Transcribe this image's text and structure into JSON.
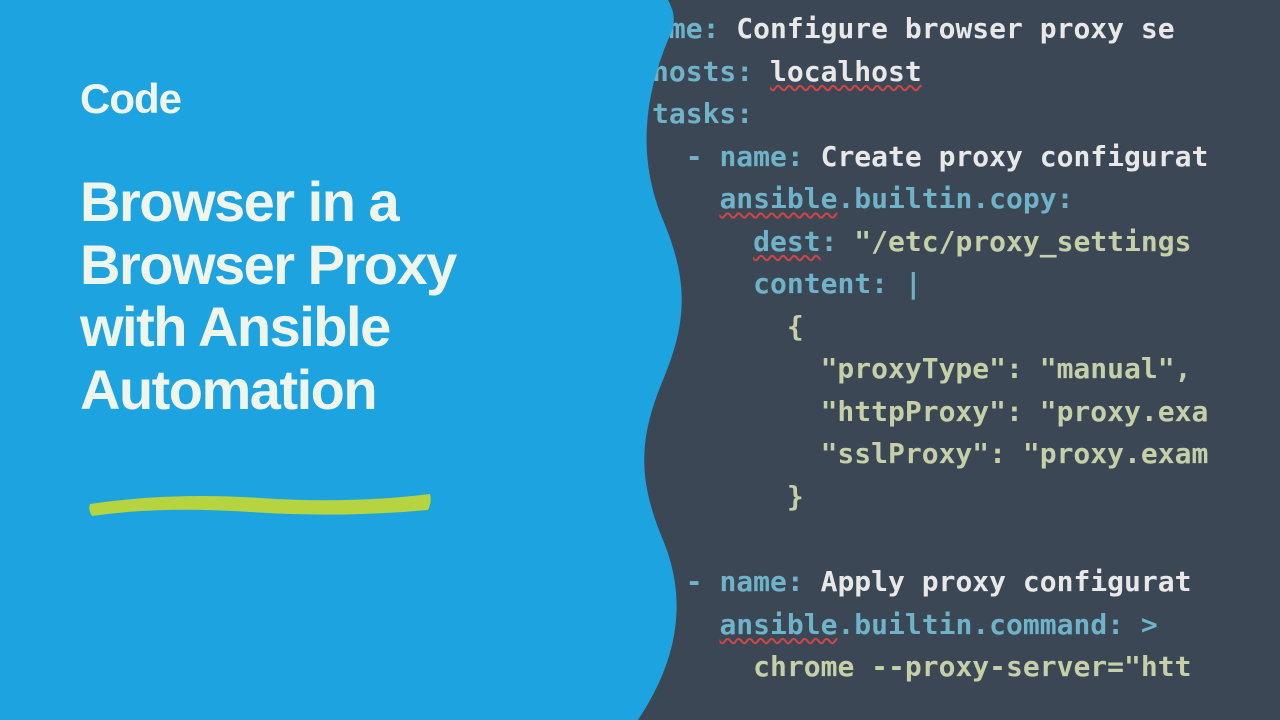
{
  "left": {
    "category": "Code",
    "title": "Browser in a Browser Proxy with Ansible Automation"
  },
  "code": {
    "l1_key": "ame:",
    "l1_val": " Configure browser proxy se",
    "l2_key": "hosts:",
    "l2_val": " localhost",
    "l3_key": "tasks:",
    "l4_dash": "  - ",
    "l4_key": "name:",
    "l4_val": " Create proxy configurat",
    "l5_pad": "    ",
    "l5_key": "ansible.builtin.copy:",
    "l6_pad": "      ",
    "l6_key": "dest:",
    "l6_val": " \"/etc/proxy_settings",
    "l7_pad": "      ",
    "l7_key": "content:",
    "l7_op": " |",
    "l8": "        {",
    "l9": "          \"proxyType\": \"manual\",",
    "l10": "          \"httpProxy\": \"proxy.exa",
    "l11": "          \"sslProxy\": \"proxy.exam",
    "l12": "        }",
    "l13": "",
    "l14_dash": "  - ",
    "l14_key": "name:",
    "l14_val": " Apply proxy configurat",
    "l15_pad": "    ",
    "l15_key": "ansible.builtin.command:",
    "l15_op": " >",
    "l16_pad": "      ",
    "l16_val": "chrome --proxy-server=\"htt"
  },
  "colors": {
    "left_bg": "#1ca3e0",
    "right_bg": "#3c4755",
    "accent": "#b6d43f",
    "text_light": "#f0f5ec",
    "code_key": "#6fb3c9",
    "code_str": "#c5d0a8",
    "squiggle": "#d24545"
  }
}
